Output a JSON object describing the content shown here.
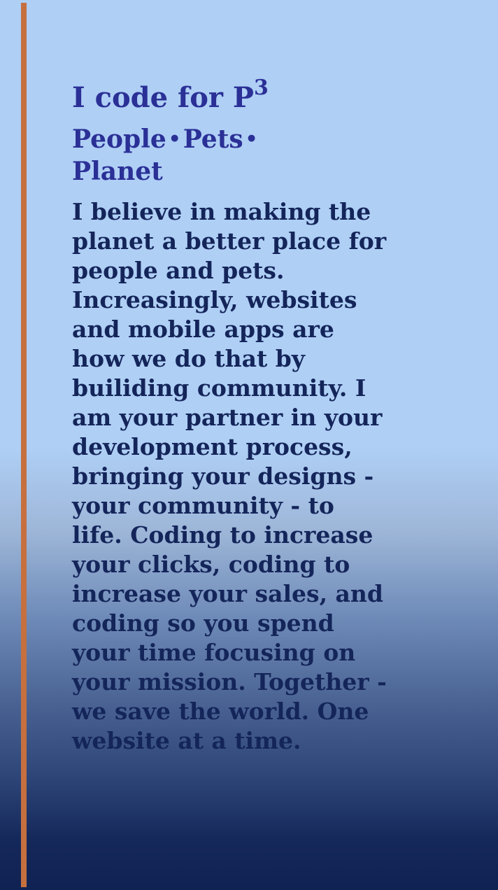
{
  "hero": {
    "headline_prefix": "I code for P",
    "headline_superscript": "3",
    "subtitle_items": [
      "People",
      "Pets",
      "Planet"
    ],
    "bullet_glyph": "•",
    "body": "I believe in making the planet a better place for people and pets. Increasingly, websites and mobile apps are how we do that by builiding community. I am your partner in your development process, bringing your designs - your community - to life. Coding to increase your clicks, coding to increase your sales, and coding so you spend your time focusing on your mission. Together - we save the world. One website at a time."
  },
  "colors": {
    "accent_bar": "#c6703f",
    "heading": "#2a3096",
    "body_text": "#14255a",
    "background_top": "#afcff5",
    "background_bottom": "#0f2252"
  }
}
